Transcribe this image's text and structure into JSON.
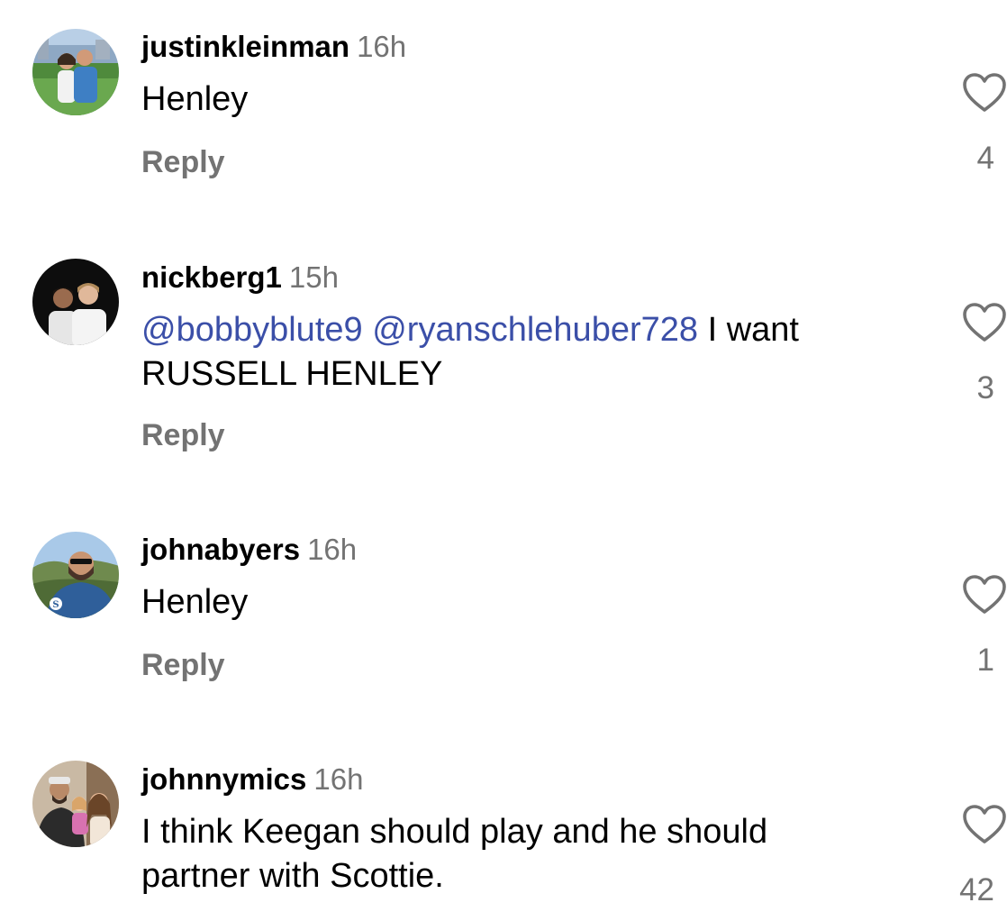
{
  "comments": [
    {
      "username": "justinkleinman",
      "time": "16h",
      "mentions": [],
      "text": "Henley",
      "reply": "Reply",
      "likes": "4",
      "avatar": "couple-at-baseball-stadium-avatar"
    },
    {
      "username": "nickberg1",
      "time": "15h",
      "mentions": [
        "@bobbyblute9",
        "@ryanschlehuber728"
      ],
      "text": "I want RUSSELL HENLEY",
      "reply": "Reply",
      "likes": "3",
      "avatar": "two-men-dark-background-avatar"
    },
    {
      "username": "johnabyers",
      "time": "16h",
      "mentions": [],
      "text": "Henley",
      "reply": "Reply",
      "likes": "1",
      "avatar": "man-sunglasses-mariners-hoodie-avatar"
    },
    {
      "username": "johnnymics",
      "time": "16h",
      "mentions": [],
      "text": "I think Keegan should play and he should partner with Scottie.",
      "reply": "",
      "likes": "42",
      "avatar": "family-selfie-avatar"
    }
  ],
  "avatar_badge_text": "SEATTLE MARINERS BASEBALL",
  "colors": {
    "mention": "#3b4fa8",
    "muted": "#737373",
    "text": "#000000"
  },
  "icons": {
    "like": "heart-outline-icon"
  }
}
